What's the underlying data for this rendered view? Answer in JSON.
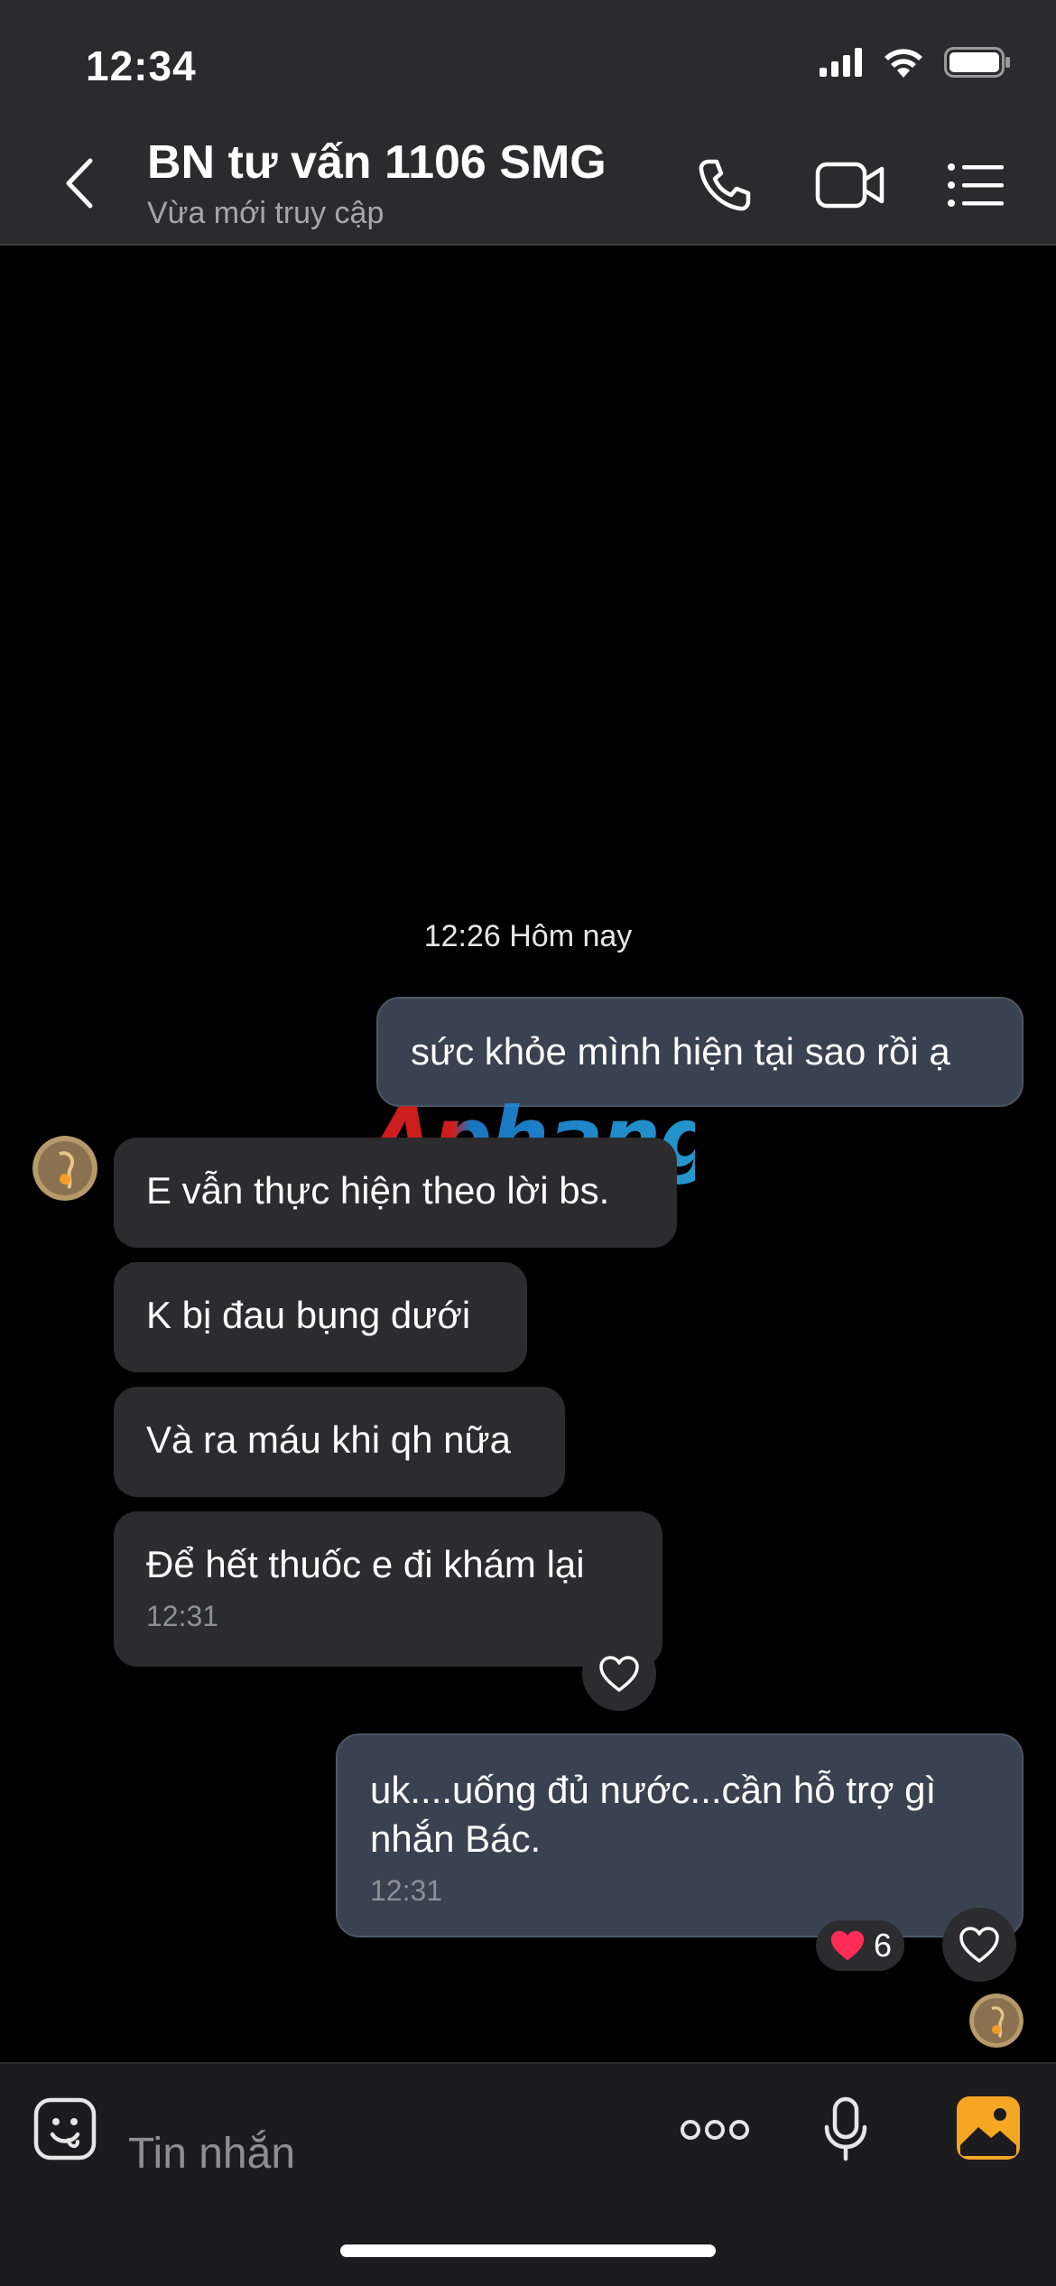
{
  "status_bar": {
    "time": "12:34"
  },
  "header": {
    "title": "BN tư vấn 1106 SMG",
    "subtitle": "Vừa mới truy cập"
  },
  "conversation": {
    "date_separator": "12:26 Hôm nay",
    "messages": [
      {
        "direction": "out",
        "text": "sức khỏe mình hiện tại sao rồi ạ"
      },
      {
        "direction": "in",
        "text": "E vẫn thực hiện theo lời bs."
      },
      {
        "direction": "in",
        "text": "K bị đau bụng dưới"
      },
      {
        "direction": "in",
        "text": "Và ra máu khi qh nữa"
      },
      {
        "direction": "in",
        "text": "Để hết thuốc e đi khám lại",
        "time": "12:31"
      },
      {
        "direction": "out",
        "text_line1": "uk....uống đủ nước...cần hỗ trợ gì",
        "text_line2": "nhắn Bác.",
        "time": "12:31",
        "reaction_count": "6"
      }
    ]
  },
  "watermark": "Aphang",
  "input": {
    "placeholder": "Tin nhắn"
  },
  "colors": {
    "outgoing_bubble": "#384250",
    "incoming_bubble": "#2c2c2e",
    "accent_orange": "#f5a623",
    "reaction_heart": "#ff2d55"
  }
}
